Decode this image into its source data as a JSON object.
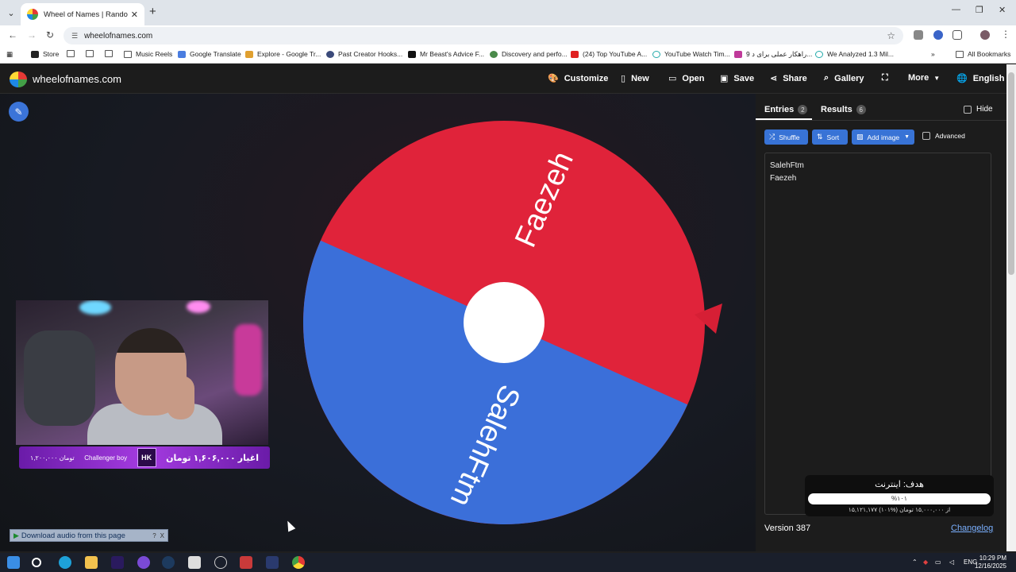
{
  "browser": {
    "tab_title": "Wheel of Names | Random name",
    "url": "wheelofnames.com"
  },
  "bookmarks": [
    "Store",
    "",
    "",
    "",
    "Music Reels",
    "Google Translate",
    "Explore - Google Tr...",
    "Past Creator Hooks...",
    "Mr Beast's Advice F...",
    "Discovery and perfo...",
    "(24) Top YouTube A...",
    "YouTube Watch Tim...",
    "9 راهکار عملی برای د...",
    "We Analyzed 1.3 Mil...",
    "All Bookmarks"
  ],
  "app": {
    "brand": "wheelofnames.com",
    "menu": [
      "Customize",
      "New",
      "Open",
      "Save",
      "Share",
      "Gallery",
      "More",
      "English"
    ]
  },
  "wheel": {
    "slices": [
      {
        "label": "Faezeh",
        "color": "#e0233a"
      },
      {
        "label": "SalehFtm",
        "color": "#3b6fd9"
      }
    ]
  },
  "overlay": {
    "donation_name": "Challenger boy",
    "donation_amount": "۱,۲۰۰,۰۰۰ تومان",
    "donation_total": "اغیار ۱,۶۰۶,۰۰۰ تومان",
    "badge": "HK",
    "download_bar": "Download audio from this page",
    "download_help": "?",
    "download_close": "X"
  },
  "sidebar": {
    "tab_entries": "Entries",
    "entries_count": "2",
    "tab_results": "Results",
    "results_count": "6",
    "hide_label": "Hide",
    "shuffle": "Shuffle",
    "sort": "Sort",
    "add_image": "Add image",
    "advanced": "Advanced",
    "entries": [
      "SalehFtm",
      "Faezeh"
    ],
    "version": "Version 387",
    "changelog": "Changelog"
  },
  "goal": {
    "title": "هدف: اینترنت",
    "percent": "%۱۰۱",
    "progress": 1.0,
    "summary": "۱۵,۱۲۱,۱۷۷ از ۱۵,۰۰۰,۰۰۰ تومان (%۱۰۱)"
  },
  "taskbar": {
    "lang": "ENG",
    "time": "10:29 PM",
    "date": "12/16/2025"
  }
}
